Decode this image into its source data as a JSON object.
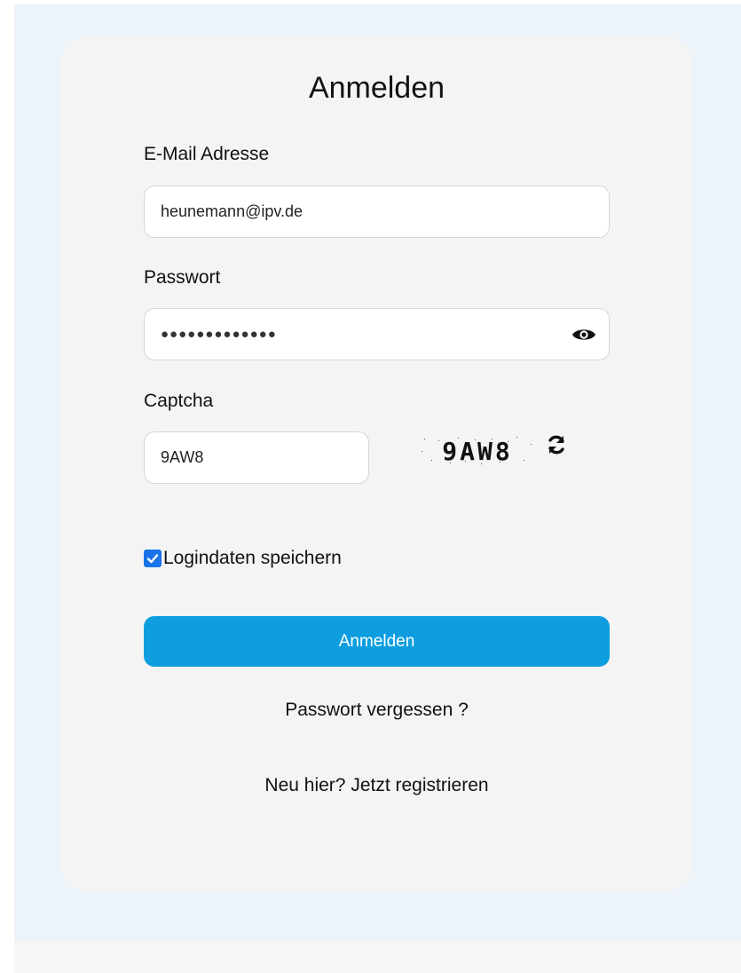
{
  "form": {
    "title": "Anmelden",
    "email_label": "E-Mail Adresse",
    "email_value": "heunemann@ipv.de",
    "password_label": "Passwort",
    "password_masked": "●●●●●●●●●●●●●",
    "captcha_label": "Captcha",
    "captcha_value": "9AW8",
    "captcha_image_text": "9AW8",
    "remember_label": "Logindaten speichern",
    "remember_checked": true,
    "submit_label": "Anmelden",
    "forgot_label": "Passwort vergessen ?",
    "register_prompt": "Neu hier?",
    "register_link": "Jetzt registrieren"
  },
  "icons": {
    "password_toggle": "eye-icon",
    "captcha_refresh": "refresh-icon",
    "checkbox": "checkmark-icon"
  },
  "colors": {
    "page_background": "#ecf3f9",
    "card_background": "#f4f4f4",
    "primary_button": "#0e9ee0",
    "checkbox": "#1a73e8"
  }
}
